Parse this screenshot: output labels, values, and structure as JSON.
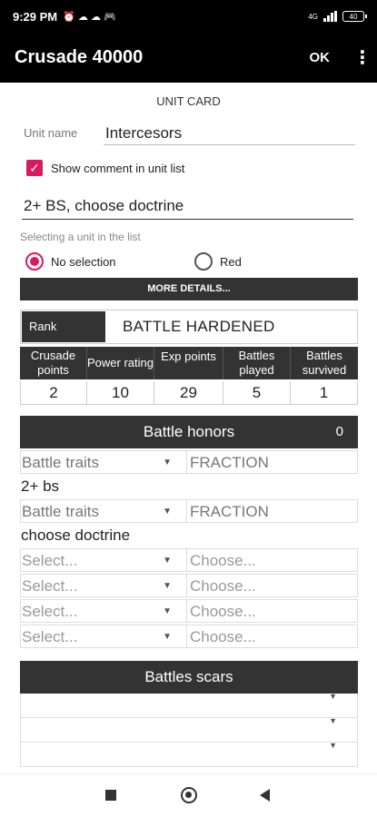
{
  "status": {
    "time": "9:29 PM",
    "notif_icons": "⏰ ☁ ☁ 🎮",
    "network": "4G",
    "battery": "40"
  },
  "appbar": {
    "title": "Crusade 40000",
    "ok_label": "OK",
    "more": "⋮"
  },
  "card": {
    "title": "UNIT CARD",
    "unit_name_label": "Unit name",
    "unit_name_value": "Intercesors",
    "show_comment_label": "Show comment in unit list",
    "show_comment_checked": true,
    "comment": "2+ BS, choose doctrine",
    "selecting_label": "Selecting a unit in the list",
    "radio_no_selection": "No selection",
    "radio_red": "Red",
    "more_details": "MORE DETAILS...",
    "rank_label": "Rank",
    "rank_value": "BATTLE HARDENED"
  },
  "stats": {
    "headers": [
      "Crusade points",
      "Power rating",
      "Exp points",
      "Battles played",
      "Battles survived"
    ],
    "values": [
      "2",
      "10",
      "29",
      "5",
      "1"
    ]
  },
  "honors": {
    "title": "Battle honors",
    "count": "0",
    "rows": [
      {
        "left": "Battle traits",
        "right": "FRACTION",
        "note": "2+ bs"
      },
      {
        "left": "Battle traits",
        "right": "FRACTION",
        "note": "choose doctrine"
      }
    ],
    "placeholders": [
      {
        "left": "Select...",
        "right": "Choose..."
      },
      {
        "left": "Select...",
        "right": "Choose..."
      },
      {
        "left": "Select...",
        "right": "Choose..."
      },
      {
        "left": "Select...",
        "right": "Choose..."
      }
    ]
  },
  "scars": {
    "title": "Battles scars"
  },
  "colors": {
    "accent": "#d81b60",
    "header_bg": "#333333",
    "appbar_bg": "#000000"
  }
}
